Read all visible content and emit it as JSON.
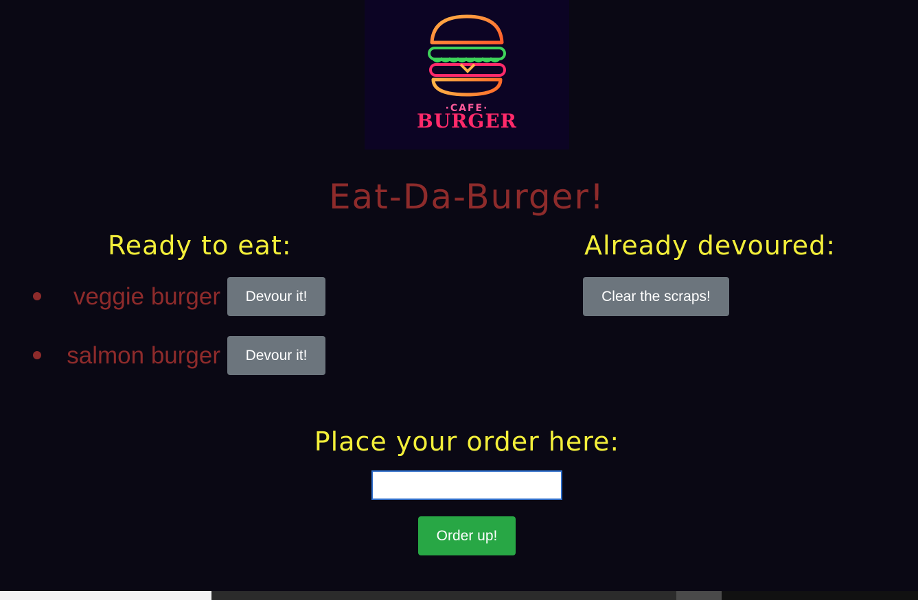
{
  "logo": {
    "cafe_text": "·CAFE·",
    "brand_text": "BURGER"
  },
  "title": "Eat-Da-Burger!",
  "ready": {
    "heading": "Ready to eat:",
    "items": [
      {
        "name": "veggie burger",
        "button_label": "Devour it!"
      },
      {
        "name": "salmon burger",
        "button_label": "Devour it!"
      }
    ]
  },
  "devoured": {
    "heading": "Already devoured:",
    "clear_button_label": "Clear the scraps!"
  },
  "order": {
    "heading": "Place your order here:",
    "input_value": "",
    "button_label": "Order up!"
  },
  "colors": {
    "background": "#0a0814",
    "title": "#8e2b2b",
    "heading": "#f3ef3a",
    "button_gray": "#6c757d",
    "button_green": "#28a745"
  }
}
